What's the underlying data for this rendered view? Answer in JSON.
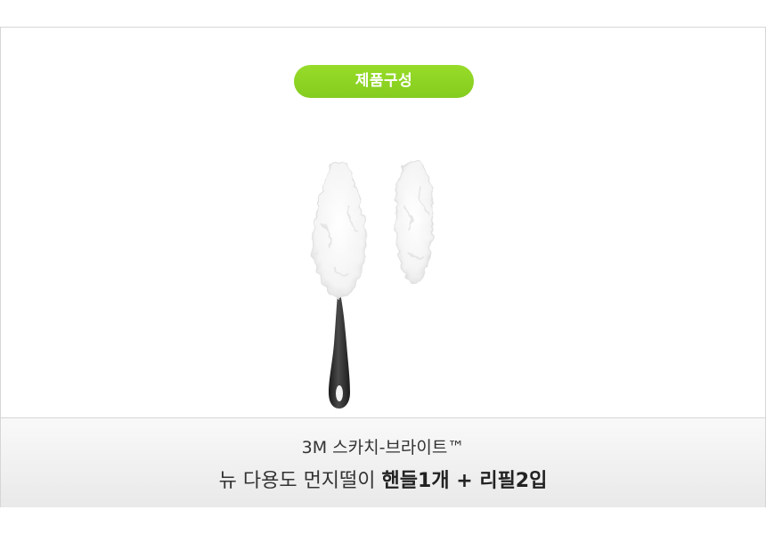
{
  "badge": {
    "label": "제품구성",
    "color": "#8ed424"
  },
  "product_image": {
    "icon": "duster-handle-and-refill-icon",
    "handle_color": "#2b2b2b",
    "fiber_color": "#ffffff"
  },
  "caption": {
    "line1": "3M 스카치-브라이트™",
    "line2_regular": "뉴 다용도 먼지떨이",
    "line2_bold": "핸들1개 + 리필2입"
  }
}
